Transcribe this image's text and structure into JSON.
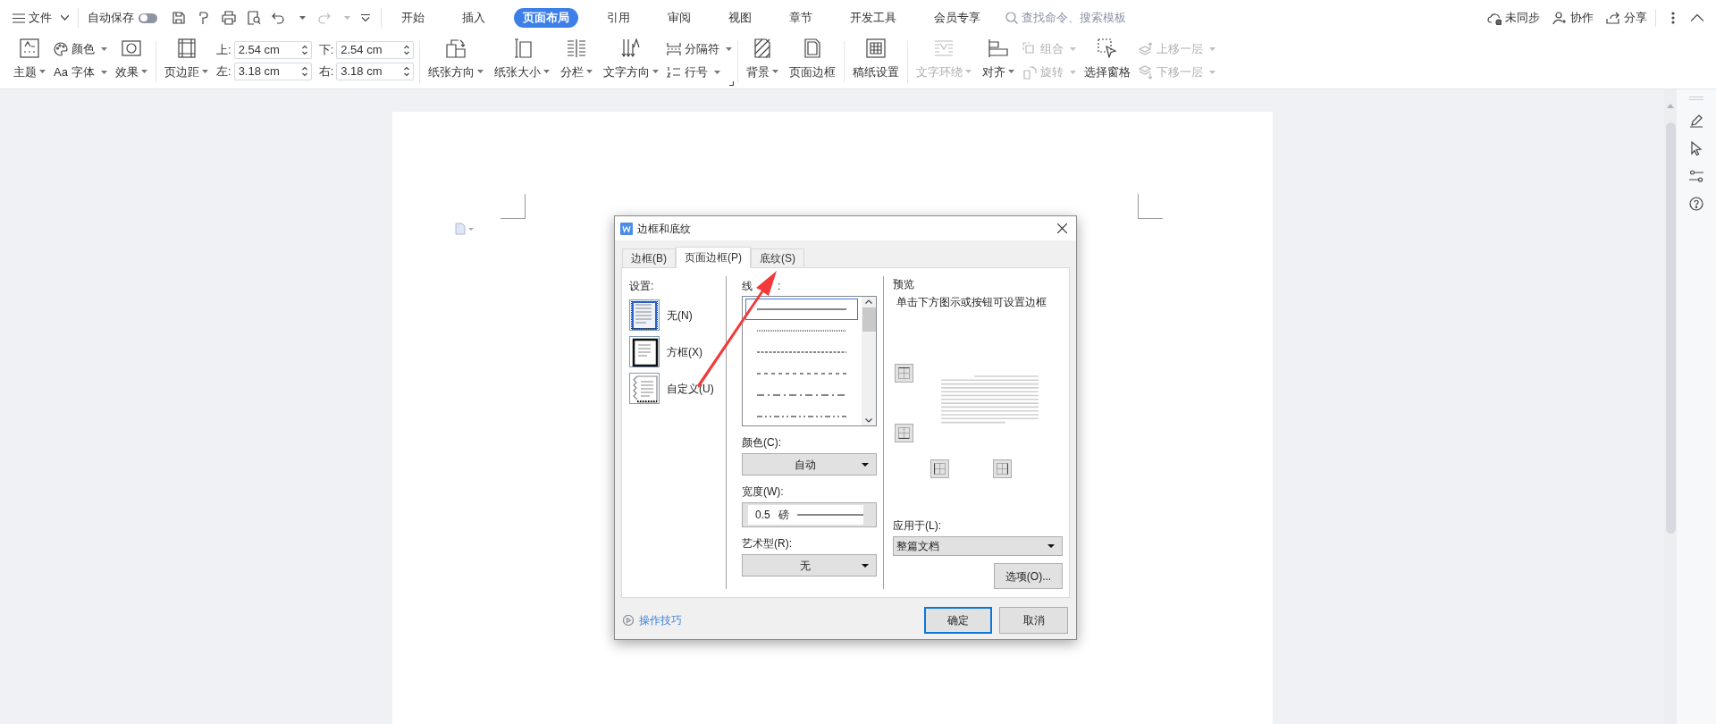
{
  "menu_bar": {
    "file_menu": "文件",
    "autosave": {
      "label": "自动保存",
      "on": false
    },
    "tabs": [
      {
        "label": "开始",
        "selected": false
      },
      {
        "label": "插入",
        "selected": false
      },
      {
        "label": "页面布局",
        "selected": true
      },
      {
        "label": "引用",
        "selected": false
      },
      {
        "label": "审阅",
        "selected": false
      },
      {
        "label": "视图",
        "selected": false
      },
      {
        "label": "章节",
        "selected": false
      },
      {
        "label": "开发工具",
        "selected": false
      },
      {
        "label": "会员专享",
        "selected": false
      }
    ],
    "search": {
      "placeholder": "查找命令、搜索模板"
    },
    "actions": [
      "未同步",
      "协作",
      "分享"
    ]
  },
  "ribbon": {
    "groups": [
      {
        "items": [
          {
            "kind": "big",
            "label": "主题",
            "dropdown": true,
            "disabled": false
          },
          {
            "kind": "stack",
            "rows": [
              {
                "label": "颜色",
                "dropdown": true,
                "disabled": false
              },
              {
                "glyph": "Aa",
                "label": "字体",
                "dropdown": true,
                "disabled": false
              }
            ]
          },
          {
            "kind": "big",
            "label": "效果",
            "dropdown": true,
            "disabled": false
          }
        ]
      },
      {
        "items": [
          {
            "kind": "big",
            "label": "页边距",
            "dropdown": true,
            "disabled": false
          },
          {
            "kind": "margins",
            "fields": [
              {
                "label": "上:",
                "value": "2.54 cm"
              },
              {
                "label": "下:",
                "value": "2.54 cm"
              },
              {
                "label": "左:",
                "value": "3.18 cm"
              },
              {
                "label": "右:",
                "value": "3.18 cm"
              }
            ]
          }
        ]
      },
      {
        "items": [
          {
            "kind": "big",
            "label": "纸张方向",
            "dropdown": true,
            "disabled": false
          },
          {
            "kind": "big",
            "label": "纸张大小",
            "dropdown": true,
            "disabled": false
          },
          {
            "kind": "big",
            "label": "分栏",
            "dropdown": true,
            "disabled": false
          },
          {
            "kind": "big",
            "label": "文字方向",
            "dropdown": true,
            "disabled": false
          },
          {
            "kind": "stack",
            "rows": [
              {
                "label": "分隔符",
                "dropdown": true,
                "disabled": false
              },
              {
                "label": "行号",
                "dropdown": true,
                "disabled": false
              }
            ]
          }
        ]
      },
      {
        "items": [
          {
            "kind": "big",
            "label": "背景",
            "dropdown": true,
            "disabled": false
          },
          {
            "kind": "big",
            "label": "页面边框",
            "dropdown": false,
            "disabled": false
          }
        ]
      },
      {
        "items": [
          {
            "kind": "big",
            "label": "稿纸设置",
            "dropdown": false,
            "disabled": false
          }
        ]
      },
      {
        "items": [
          {
            "kind": "big",
            "label": "文字环绕",
            "dropdown": true,
            "disabled": true
          },
          {
            "kind": "big",
            "label": "对齐",
            "dropdown": true,
            "disabled": false
          },
          {
            "kind": "stack",
            "rows": [
              {
                "label": "组合",
                "dropdown": true,
                "disabled": true
              },
              {
                "label": "旋转",
                "dropdown": true,
                "disabled": true
              }
            ]
          },
          {
            "kind": "big",
            "label": "选择窗格",
            "dropdown": false,
            "disabled": false
          },
          {
            "kind": "stack",
            "rows": [
              {
                "label": "上移一层",
                "dropdown": true,
                "disabled": true
              },
              {
                "label": "下移一层",
                "dropdown": true,
                "disabled": true
              }
            ]
          }
        ]
      }
    ]
  },
  "dialog": {
    "title": "边框和底纹",
    "tabs": [
      {
        "label": "边框(B)",
        "selected": false
      },
      {
        "label": "页面边框(P)",
        "selected": true
      },
      {
        "label": "底纹(S)",
        "selected": false
      }
    ],
    "settings": {
      "label": "设置:",
      "options": [
        {
          "label": "无(N)",
          "selected": true
        },
        {
          "label": "方框(X)",
          "selected": false
        },
        {
          "label": "自定义(U)",
          "selected": false
        }
      ]
    },
    "line_style": {
      "label": "线",
      "label_end": ":",
      "styles": [
        {
          "kind": "solid",
          "selected": true
        },
        {
          "kind": "dotted",
          "selected": false
        },
        {
          "kind": "dashed-fine",
          "selected": false
        },
        {
          "kind": "dashed",
          "selected": false
        },
        {
          "kind": "dash-dot",
          "selected": false
        },
        {
          "kind": "dash-dot-dot",
          "selected": false
        }
      ]
    },
    "color": {
      "label": "颜色(C):",
      "value": "自动"
    },
    "width": {
      "label": "宽度(W):",
      "value": "0.5",
      "unit": "磅"
    },
    "art": {
      "label": "艺术型(R):",
      "value": "无"
    },
    "preview": {
      "label": "预览",
      "hint": "单击下方图示或按钮可设置边框"
    },
    "apply_to": {
      "label": "应用于(L):",
      "value": "整篇文档"
    },
    "options_button": "选项(O)...",
    "tips": "操作技巧",
    "ok_button": "确定",
    "cancel_button": "取消"
  }
}
